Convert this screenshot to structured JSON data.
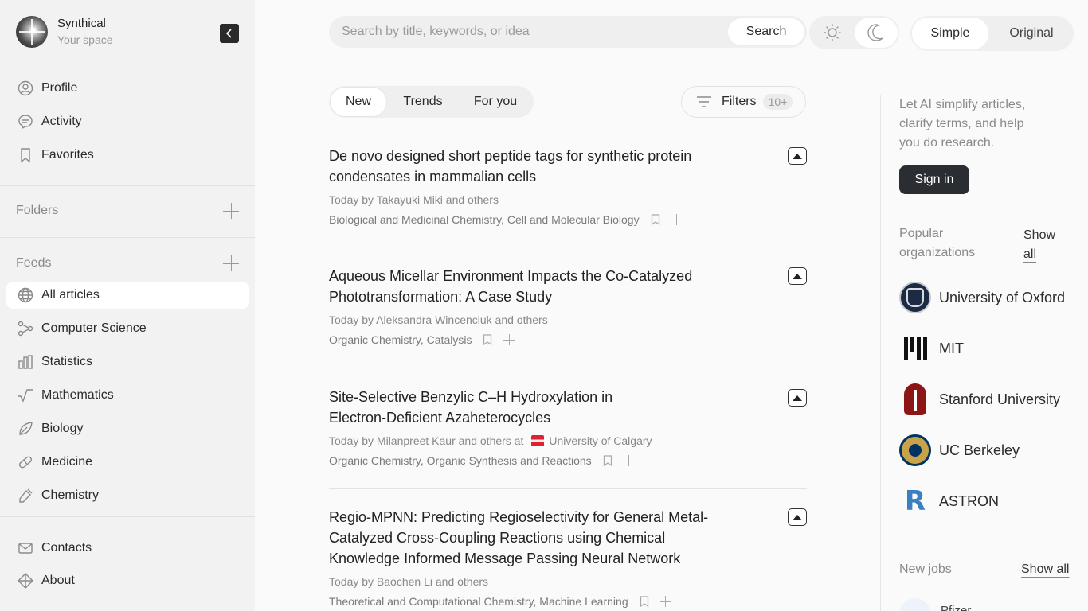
{
  "brand": {
    "name": "Synthical",
    "subtitle": "Your space"
  },
  "sidebar": {
    "top_items": [
      {
        "label": "Profile",
        "icon": "profile-icon"
      },
      {
        "label": "Activity",
        "icon": "chat-bubble-icon"
      },
      {
        "label": "Favorites",
        "icon": "bookmark-icon"
      }
    ],
    "folders_label": "Folders",
    "feeds_label": "Feeds",
    "feeds": [
      {
        "label": "All articles",
        "icon": "globe-icon",
        "active": true
      },
      {
        "label": "Computer Science",
        "icon": "graph-nodes-icon"
      },
      {
        "label": "Statistics",
        "icon": "bar-chart-icon"
      },
      {
        "label": "Mathematics",
        "icon": "square-root-icon"
      },
      {
        "label": "Biology",
        "icon": "leaf-icon"
      },
      {
        "label": "Medicine",
        "icon": "pill-icon"
      },
      {
        "label": "Chemistry",
        "icon": "pipette-icon"
      }
    ],
    "bottom_items": [
      {
        "label": "Contacts",
        "icon": "envelope-icon"
      },
      {
        "label": "About",
        "icon": "diamond-icon"
      }
    ]
  },
  "search": {
    "placeholder": "Search by title, keywords, or idea",
    "value": "",
    "button_label": "Search"
  },
  "mode": {
    "simple": "Simple",
    "original": "Original",
    "selected": "Simple"
  },
  "feed_tabs": [
    {
      "label": "New",
      "active": true
    },
    {
      "label": "Trends"
    },
    {
      "label": "For you"
    }
  ],
  "filters": {
    "label": "Filters",
    "badge": "10+"
  },
  "articles": [
    {
      "title": "De novo designed short peptide tags for synthetic protein condensates in mammalian cells",
      "meta": "Today by Takayuki Miki and others",
      "tags": "Biological and Medicinal Chemistry, Cell and Molecular Biology"
    },
    {
      "title": "Aqueous Micellar Environment Impacts the Co-Catalyzed Phototransformation: A Case Study",
      "meta": "Today by Aleksandra Wincenciuk and others",
      "tags": "Organic Chemistry, Catalysis"
    },
    {
      "title": "Site-Selective Benzylic C–H Hydroxylation in Electron-Deficient Azaheterocycles",
      "meta": "Today by Milanpreet Kaur and others at",
      "org": "University of Calgary",
      "tags": "Organic Chemistry, Organic Synthesis and Reactions"
    },
    {
      "title": "Regio-MPNN: Predicting Regioselectivity for General Metal-Catalyzed Cross-Coupling Reactions using Chemical Knowledge Informed Message Passing Neural Network",
      "meta": "Today by Baochen Li and others",
      "tags": "Theoretical and Computational Chemistry, Machine Learning"
    }
  ],
  "right_panel": {
    "promo": "Let AI simplify articles, clarify terms, and help you do research.",
    "signin_label": "Sign in",
    "popular_heading": "Popular organizations",
    "show_all_label": "Show all",
    "organizations": [
      {
        "name": "University of Oxford"
      },
      {
        "name": "MIT"
      },
      {
        "name": "Stanford University"
      },
      {
        "name": "UC Berkeley"
      },
      {
        "name": "ASTRON"
      }
    ],
    "jobs_heading": "New jobs",
    "jobs_show_all": "Show all",
    "job_preview": "Pfizer"
  }
}
